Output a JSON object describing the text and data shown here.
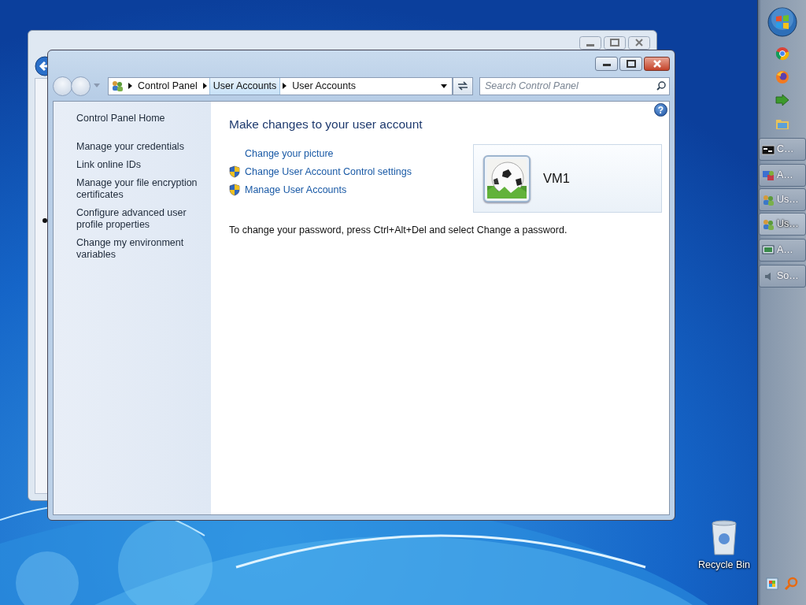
{
  "desktop": {
    "icons": [
      {
        "label": "Recycle Bin"
      }
    ]
  },
  "taskbar": {
    "pinned": [
      {
        "kind": "start"
      },
      {
        "kind": "chrome"
      },
      {
        "kind": "firefox"
      },
      {
        "kind": "arrows"
      },
      {
        "kind": "folder"
      }
    ],
    "buttons": [
      {
        "label": "C…",
        "kind": "console",
        "selected": false
      },
      {
        "label": "A…",
        "kind": "network",
        "selected": false
      },
      {
        "label": "Us…",
        "kind": "users",
        "selected": false
      },
      {
        "label": "Us…",
        "kind": "users",
        "selected": true
      },
      {
        "label": "A…",
        "kind": "monitor",
        "selected": false
      },
      {
        "label": "So…",
        "kind": "speaker",
        "selected": false
      }
    ]
  },
  "window": {
    "address": {
      "crumbs": [
        {
          "label": "Control Panel",
          "highlighted": false
        },
        {
          "label": "User Accounts",
          "highlighted": true
        },
        {
          "label": "User Accounts",
          "highlighted": false
        }
      ]
    },
    "search": {
      "placeholder": "Search Control Panel"
    },
    "help": "?",
    "sidebar": {
      "items": [
        {
          "label": "Control Panel Home"
        },
        {
          "label": "Manage your credentials"
        },
        {
          "label": "Link online IDs"
        },
        {
          "label": "Manage your file encryption certificates"
        },
        {
          "label": "Configure advanced user profile properties"
        },
        {
          "label": "Change my environment variables"
        }
      ]
    },
    "heading": "Make changes to your user account",
    "tasks": [
      {
        "label": "Change your picture",
        "kind": "plain"
      },
      {
        "label": "Change User Account Control settings",
        "kind": "shield"
      },
      {
        "label": "Manage User Accounts",
        "kind": "shield"
      }
    ],
    "account": {
      "name": "VM1"
    },
    "note": "To change your password, press Ctrl+Alt+Del and select Change a password."
  }
}
